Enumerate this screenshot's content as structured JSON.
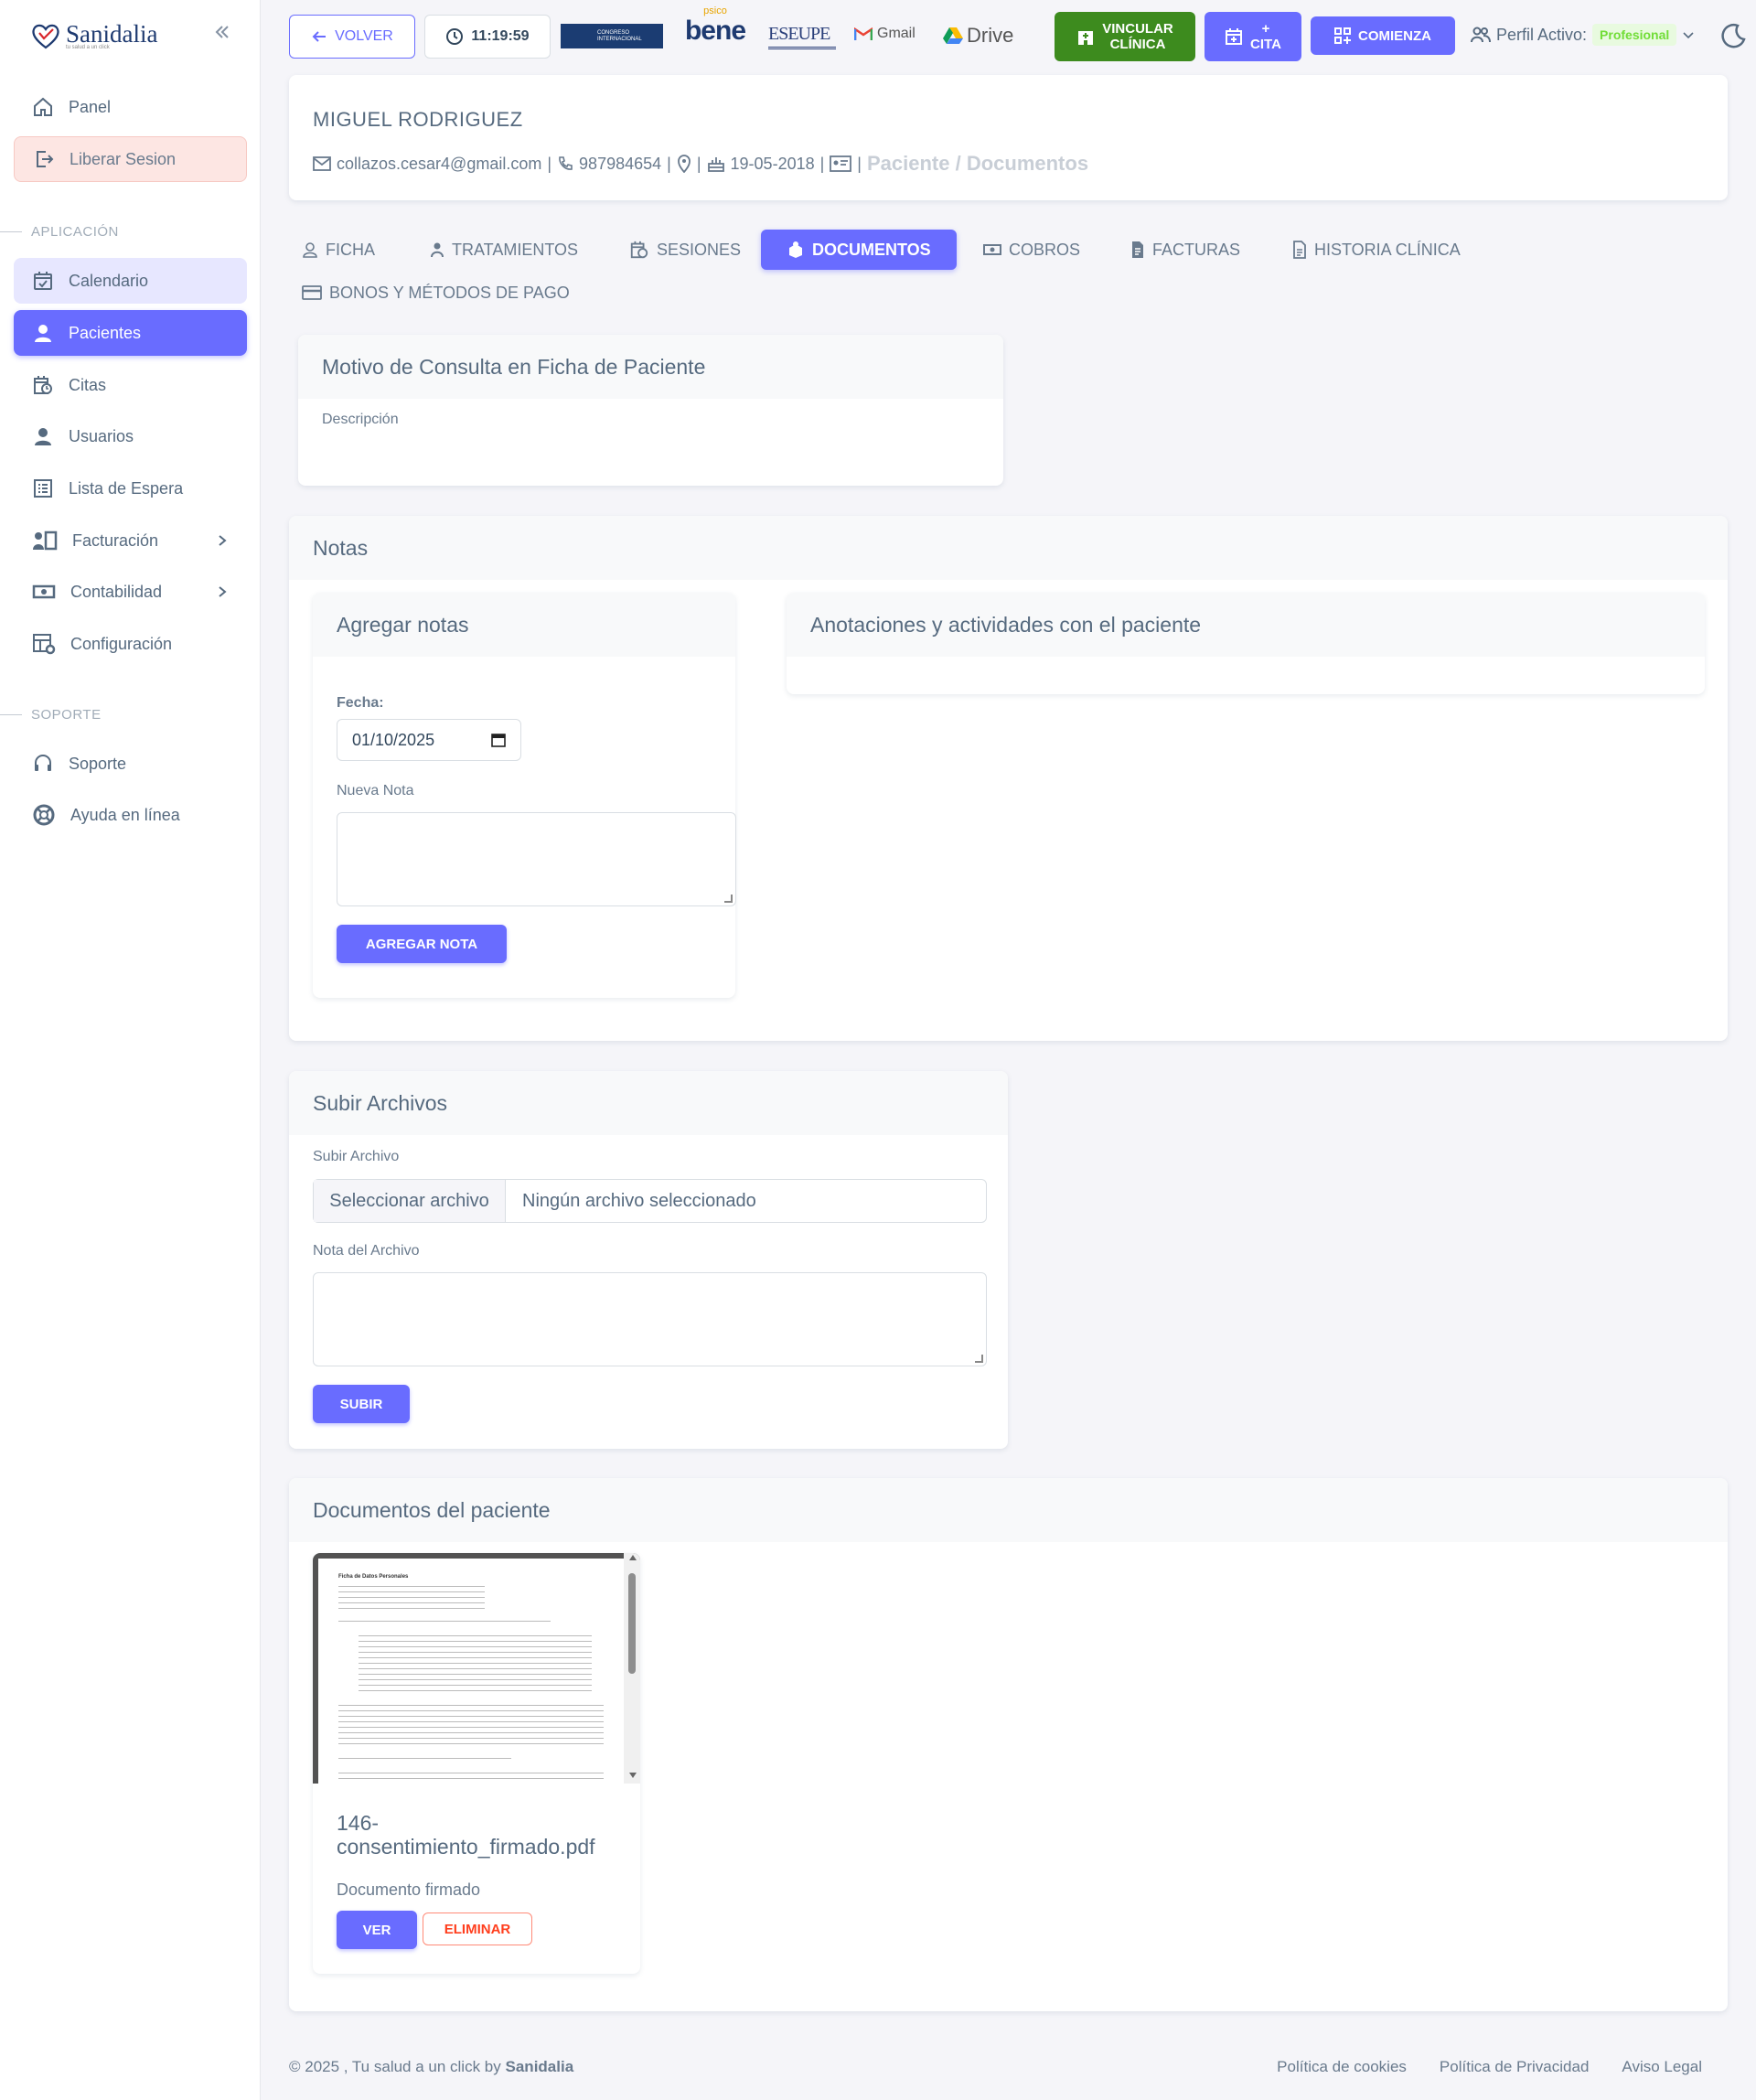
{
  "brand": {
    "name": "Sanidalia",
    "tagline": "tu salud a un click"
  },
  "sidebar": {
    "items": [
      {
        "label": "Panel",
        "icon": "home-icon"
      },
      {
        "label": "Liberar Sesion",
        "icon": "logout-icon"
      },
      {
        "label": "Calendario",
        "icon": "calendar-check-icon"
      },
      {
        "label": "Pacientes",
        "icon": "user-icon"
      },
      {
        "label": "Citas",
        "icon": "calendar-clock-icon"
      },
      {
        "label": "Usuarios",
        "icon": "user-icon"
      },
      {
        "label": "Lista de Espera",
        "icon": "list-icon"
      },
      {
        "label": "Facturación",
        "icon": "billing-icon"
      },
      {
        "label": "Contabilidad",
        "icon": "money-icon"
      },
      {
        "label": "Configuración",
        "icon": "settings-icon"
      },
      {
        "label": "Soporte",
        "icon": "headset-icon"
      },
      {
        "label": "Ayuda en línea",
        "icon": "lifebuoy-icon"
      }
    ],
    "section_app": "APLICACIÓN",
    "section_support": "SOPORTE"
  },
  "topbar": {
    "back": "VOLVER",
    "clock": "11:19:59",
    "congreso": "CONGRESO INTERNACIONAL",
    "psico": "psico",
    "bene": "bene",
    "eseupe": "ESEUPE",
    "gmail": "Gmail",
    "drive": "Drive",
    "vincular_1": "VINCULAR",
    "vincular_2": "CLÍNICA",
    "cita_plus": "+",
    "cita": "CITA",
    "comienza": "COMIENZA",
    "perfil_label": "Perfil Activo:",
    "perfil_value": "Profesional"
  },
  "patient": {
    "name": "MIGUEL RODRIGUEZ",
    "email": "collazos.cesar4@gmail.com",
    "phone": "987984654",
    "birthdate": "19-05-2018",
    "breadcrumb": "Paciente / Documentos",
    "sep": "|"
  },
  "tabs": [
    {
      "label": "FICHA"
    },
    {
      "label": "TRATAMIENTOS"
    },
    {
      "label": "SESIONES"
    },
    {
      "label": "DOCUMENTOS"
    },
    {
      "label": "COBROS"
    },
    {
      "label": "FACTURAS"
    },
    {
      "label": "HISTORIA CLÍNICA"
    },
    {
      "label": "BONOS Y MÉTODOS DE PAGO"
    }
  ],
  "motivo": {
    "title": "Motivo de Consulta en Ficha de Paciente",
    "desc_label": "Descripción"
  },
  "notas": {
    "title": "Notas",
    "add_title": "Agregar notas",
    "fecha_label": "Fecha:",
    "fecha_value": "01/10/2025",
    "nueva_label": "Nueva Nota",
    "add_button": "AGREGAR NOTA",
    "activity_title": "Anotaciones y actividades con el paciente"
  },
  "upload": {
    "title": "Subir Archivos",
    "file_label": "Subir Archivo",
    "choose": "Seleccionar archivo",
    "none": "Ningún archivo seleccionado",
    "note_label": "Nota del Archivo",
    "submit": "SUBIR"
  },
  "documents": {
    "title": "Documentos del paciente",
    "items": [
      {
        "name_1": "146-",
        "name_2": "consentimiento_firmado.pdf",
        "desc": "Documento firmado",
        "view": "VER",
        "delete": "ELIMINAR",
        "preview_title": "Ficha de Datos Personales"
      }
    ]
  },
  "footer": {
    "copyright": "© 2025 , Tu salud a un click by",
    "brand": "Sanidalia",
    "cookies": "Política de cookies",
    "privacy": "Política de Privacidad",
    "legal": "Aviso Legal"
  },
  "colors": {
    "primary": "#696cff",
    "green": "#3d8b1e",
    "danger": "#ff3e1d"
  }
}
